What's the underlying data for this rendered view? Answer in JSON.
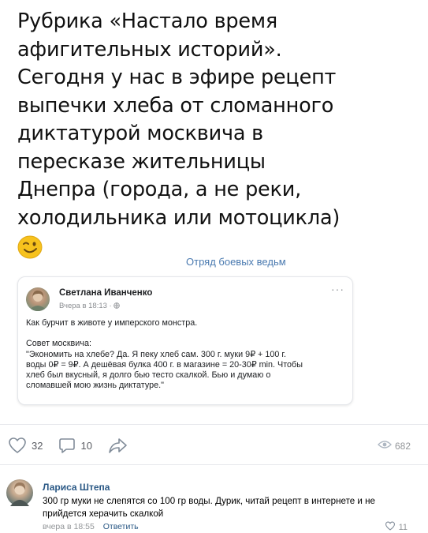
{
  "post": {
    "text": "Рубрика «Настало время\nафигительных историй».\nСегодня у нас в эфире рецепт\nвыпечки хлеба от сломанного\nдиктатурой москвича в\nпересказе жительницы\nДнепра (города, а не реки,\nхолодильника или мотоцикла)",
    "emoji": "winking-face-emoji",
    "group_tag": "Отряд боевых ведьм"
  },
  "repost": {
    "author": "Светлана Иванченко",
    "meta": "Вчера в 18:13 · ",
    "privacy_icon": "globe-icon",
    "more_label": "···",
    "body": "Как бурчит в животе у имперского монстра.\n\nСовет москвича:\n\"Экономить на хлебе? Да. Я пеку хлеб сам. 300 г. муки 9₽ + 100 г.\nводы 0₽ = 9₽. А дешёвая булка 400 г. в магазине = 20-30₽ min. Чтобы\nхлеб был вкусный, я долго бью тесто скалкой. Бью и думаю о\nсломавшей мою жизнь диктатуре.\""
  },
  "actions": {
    "likes": "32",
    "comments": "10",
    "views": "682"
  },
  "comment": {
    "author": "Лариса Штепа",
    "text": "300 гр муки не слепятся со 100 гр воды. Дурик, читай рецепт в интернете и не прийдется херачить скалкой",
    "time": "вчера в 18:55",
    "reply_label": "Ответить",
    "likes": "11"
  },
  "colors": {
    "link": "#2a5885",
    "group_tag": "#4a7ab0",
    "muted": "#939699"
  }
}
